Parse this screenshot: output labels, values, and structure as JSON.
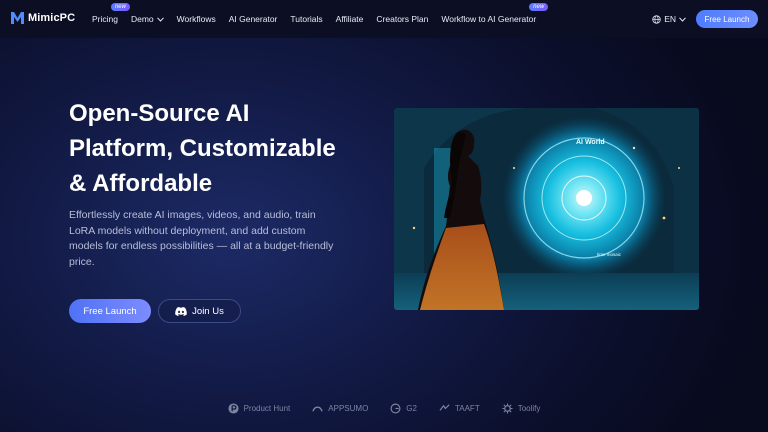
{
  "brand": {
    "name": "MimicPC"
  },
  "nav": {
    "items": [
      {
        "label": "Pricing",
        "badge": "new"
      },
      {
        "label": "Demo",
        "dropdown": true
      },
      {
        "label": "Workflows"
      },
      {
        "label": "AI Generator"
      },
      {
        "label": "Tutorials"
      },
      {
        "label": "Affiliate"
      },
      {
        "label": "Creators Plan"
      },
      {
        "label": "Workflow to AI Generator",
        "badge": "new"
      }
    ],
    "language": "EN",
    "cta": "Free Launch"
  },
  "hero": {
    "title_lines": [
      "Open-Source AI",
      "Platform, Customizable",
      "& Affordable"
    ],
    "description": "Effortlessly create AI images, videos, and audio, train LoRA models without deployment, and add custom models for endless possibilities — all at a budget-friendly price.",
    "primary_button": "Free Launch",
    "secondary_button": "Join Us",
    "image": {
      "caption_top": "AI World",
      "caption_bottom": "time mosaic"
    }
  },
  "partners": [
    {
      "name": "Product Hunt",
      "icon": "product-hunt-icon"
    },
    {
      "name": "APPSUMO",
      "icon": "appsumo-icon"
    },
    {
      "name": "G2",
      "icon": "g2-icon"
    },
    {
      "name": "TAAFT",
      "icon": "taaft-icon"
    },
    {
      "name": "Toolify",
      "icon": "toolify-icon"
    }
  ],
  "colors": {
    "accent": "#4f7cff",
    "badge": "#6a6cff",
    "background": "#0b0f2b"
  }
}
